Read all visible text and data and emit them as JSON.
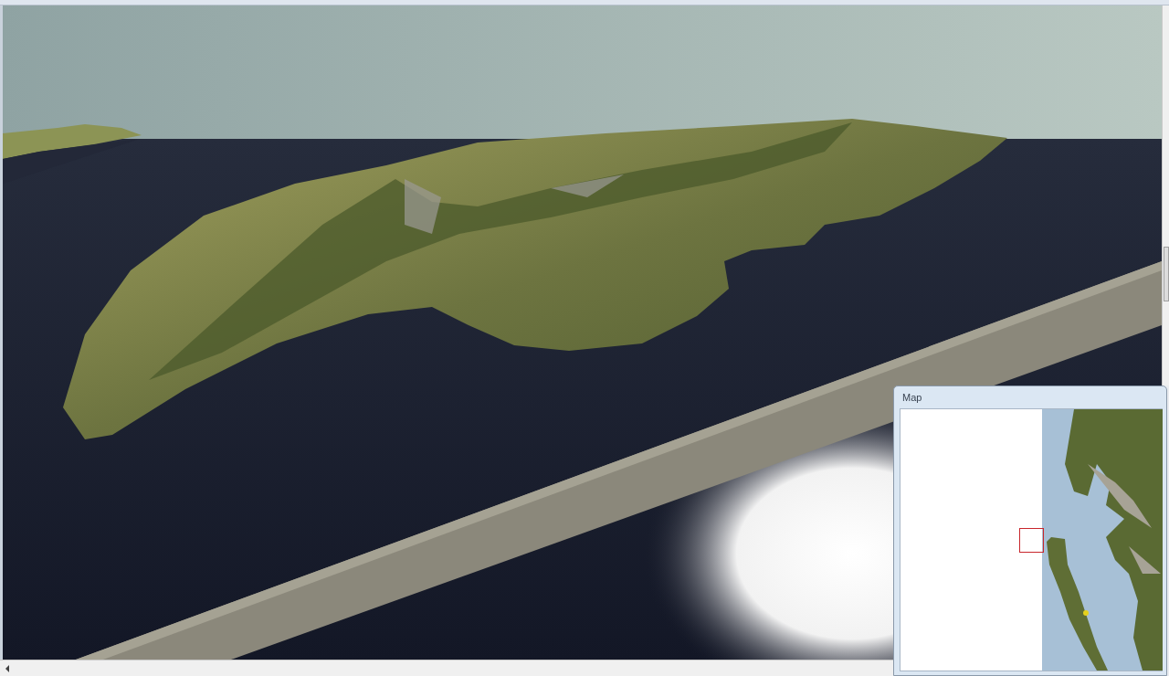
{
  "map_panel": {
    "title": "Map"
  }
}
